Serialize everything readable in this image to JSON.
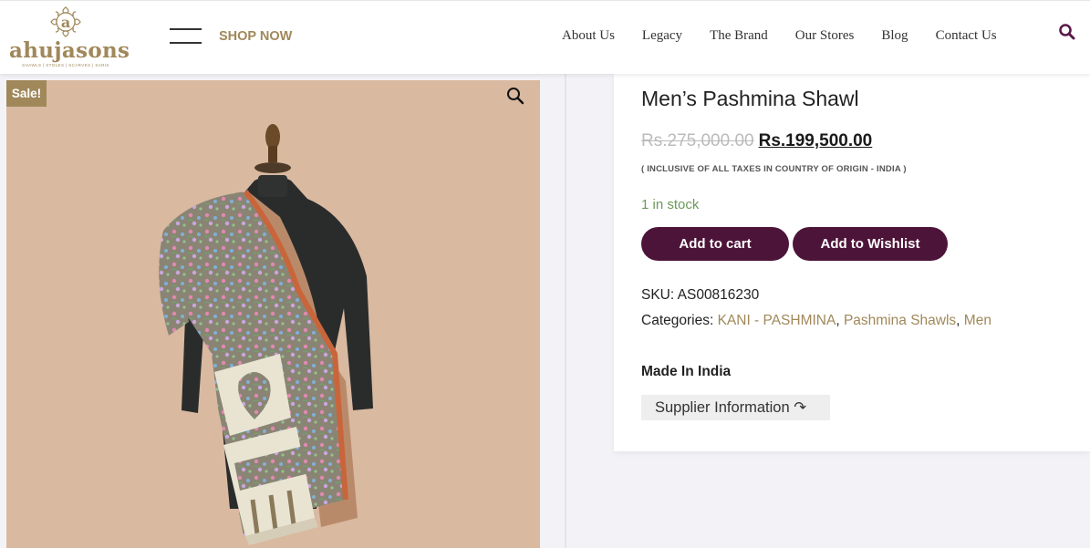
{
  "brand": {
    "logo_letter": "a",
    "name": "ahujasons",
    "tagline": "SHAWLS | STOLES | SCARVES | SARIS",
    "color": "#a0885a"
  },
  "header": {
    "shop_now": "SHOP NOW",
    "nav": [
      "About Us",
      "Legacy",
      "The Brand",
      "Our Stores",
      "Blog",
      "Contact Us"
    ],
    "search_icon": "search-icon"
  },
  "gallery": {
    "sale_badge": "Sale!",
    "zoom_icon": "magnifier-icon",
    "background": "#d9b9a0"
  },
  "product": {
    "title": "Men’s Pashmina Shawl",
    "price_old": "Rs.275,000.00",
    "price_new": "Rs.199,500.00",
    "tax_note": "( INCLUSIVE OF ALL TAXES IN COUNTRY OF ORIGIN - INDIA )",
    "stock": "1 in stock",
    "add_to_cart": "Add to cart",
    "add_to_wishlist": "Add to Wishlist",
    "sku_label": "SKU:",
    "sku_value": "AS00816230",
    "categories_label": "Categories:",
    "categories": [
      "KANI - PASHMINA",
      "Pashmina Shawls",
      "Men"
    ],
    "category_sep": ", ",
    "made_in": "Made In India",
    "supplier_info": "Supplier Information ↷"
  },
  "colors": {
    "button": "#4d1439",
    "gold": "#a0885a",
    "stock": "#6b9a5a"
  }
}
